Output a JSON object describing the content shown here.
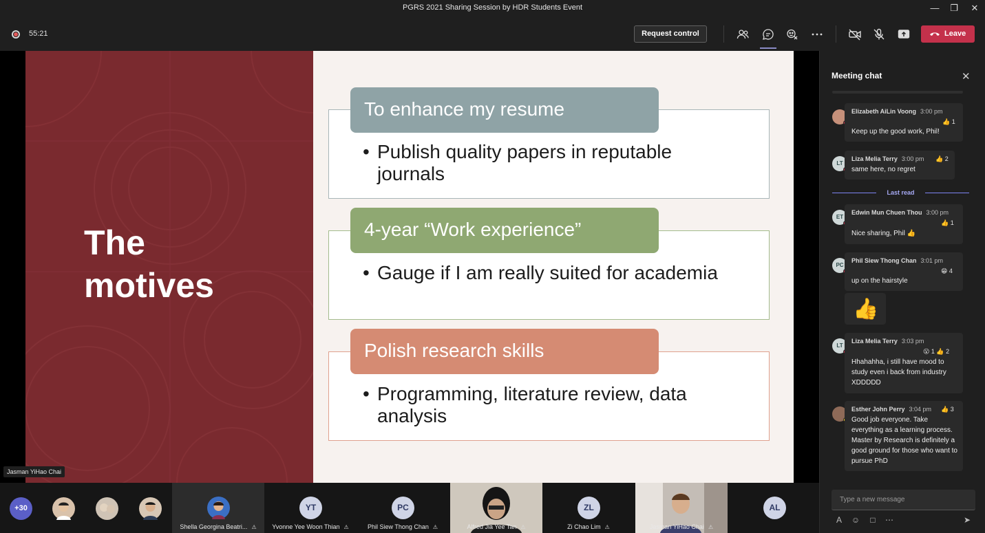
{
  "window": {
    "title": "PGRS 2021 Sharing Session by HDR Students Event"
  },
  "toolbar": {
    "timer": "55:21",
    "request_control_label": "Request control",
    "leave_label": "Leave",
    "icons": [
      "participants-icon",
      "chat-icon",
      "reactions-icon",
      "more-icon",
      "camera-off-icon",
      "mic-off-icon",
      "share-icon",
      "phone-icon"
    ]
  },
  "slide": {
    "title_line1": "The",
    "title_line2": "motives",
    "sections": [
      {
        "heading": "To enhance my resume",
        "bullet": "Publish quality papers in reputable journals",
        "color": "#8fa3a6"
      },
      {
        "heading": "4-year “Work experience”",
        "bullet": "Gauge if I am really suited for academia",
        "color": "#8fa872"
      },
      {
        "heading": "Polish research skills",
        "bullet": "Programming, literature review, data analysis",
        "color": "#d58b73"
      }
    ],
    "bullet_symbol": "•"
  },
  "speaker_label": "Jasman YiHao Chai",
  "chat": {
    "title": "Meeting chat",
    "close_icon": "✕",
    "last_read_label": "Last read",
    "compose_placeholder": "Type a new message",
    "messages": [
      {
        "author": "Elizabeth AiLin Voong",
        "time": "3:00 pm",
        "reaction": "👍 1",
        "text": "Keep up the good work, Phil!",
        "initials": ""
      },
      {
        "author": "Liza Melia Terry",
        "time": "3:00 pm",
        "reaction": "👍 2",
        "text": "same here, no regret",
        "initials": "LT"
      },
      {
        "author": "Edwin Mun Chuen Thou",
        "time": "3:00 pm",
        "reaction": "👍 1",
        "text": "Nice sharing, Phil 👍",
        "initials": "ET"
      },
      {
        "author": "Phil Siew Thong Chan",
        "time": "3:01 pm",
        "reaction": "😁 4",
        "text": "up on the hairstyle",
        "initials": "PC",
        "emoji": "👍"
      },
      {
        "author": "Liza Melia Terry",
        "time": "3:03 pm",
        "reaction": "😮 1  👍 2",
        "text": "Hhahahha, i still have mood to study even i back from industry XDDDDD",
        "initials": "LT"
      },
      {
        "author": "Esther John Perry",
        "time": "3:04 pm",
        "reaction": "👍 3",
        "text": "Good job everyone. Take everything as a learning process. Master by Research is definitely a good ground for those who want to pursue PhD",
        "initials": ""
      }
    ]
  },
  "participants": {
    "overflow": "+30",
    "tiles": [
      {
        "name": "Shella Georgina Beatri...",
        "initials": ""
      },
      {
        "name": "Yvonne Yee Woon Thian",
        "initials": "YT"
      },
      {
        "name": "Phil Siew Thong Chan",
        "initials": "PC"
      },
      {
        "name": "Alfred Jia Yee Tan",
        "initials": ""
      },
      {
        "name": "Zi Chao Lim",
        "initials": "ZL"
      },
      {
        "name": "Jasman YiHao Chai",
        "initials": ""
      },
      {
        "name": "",
        "initials": "AL"
      }
    ]
  }
}
